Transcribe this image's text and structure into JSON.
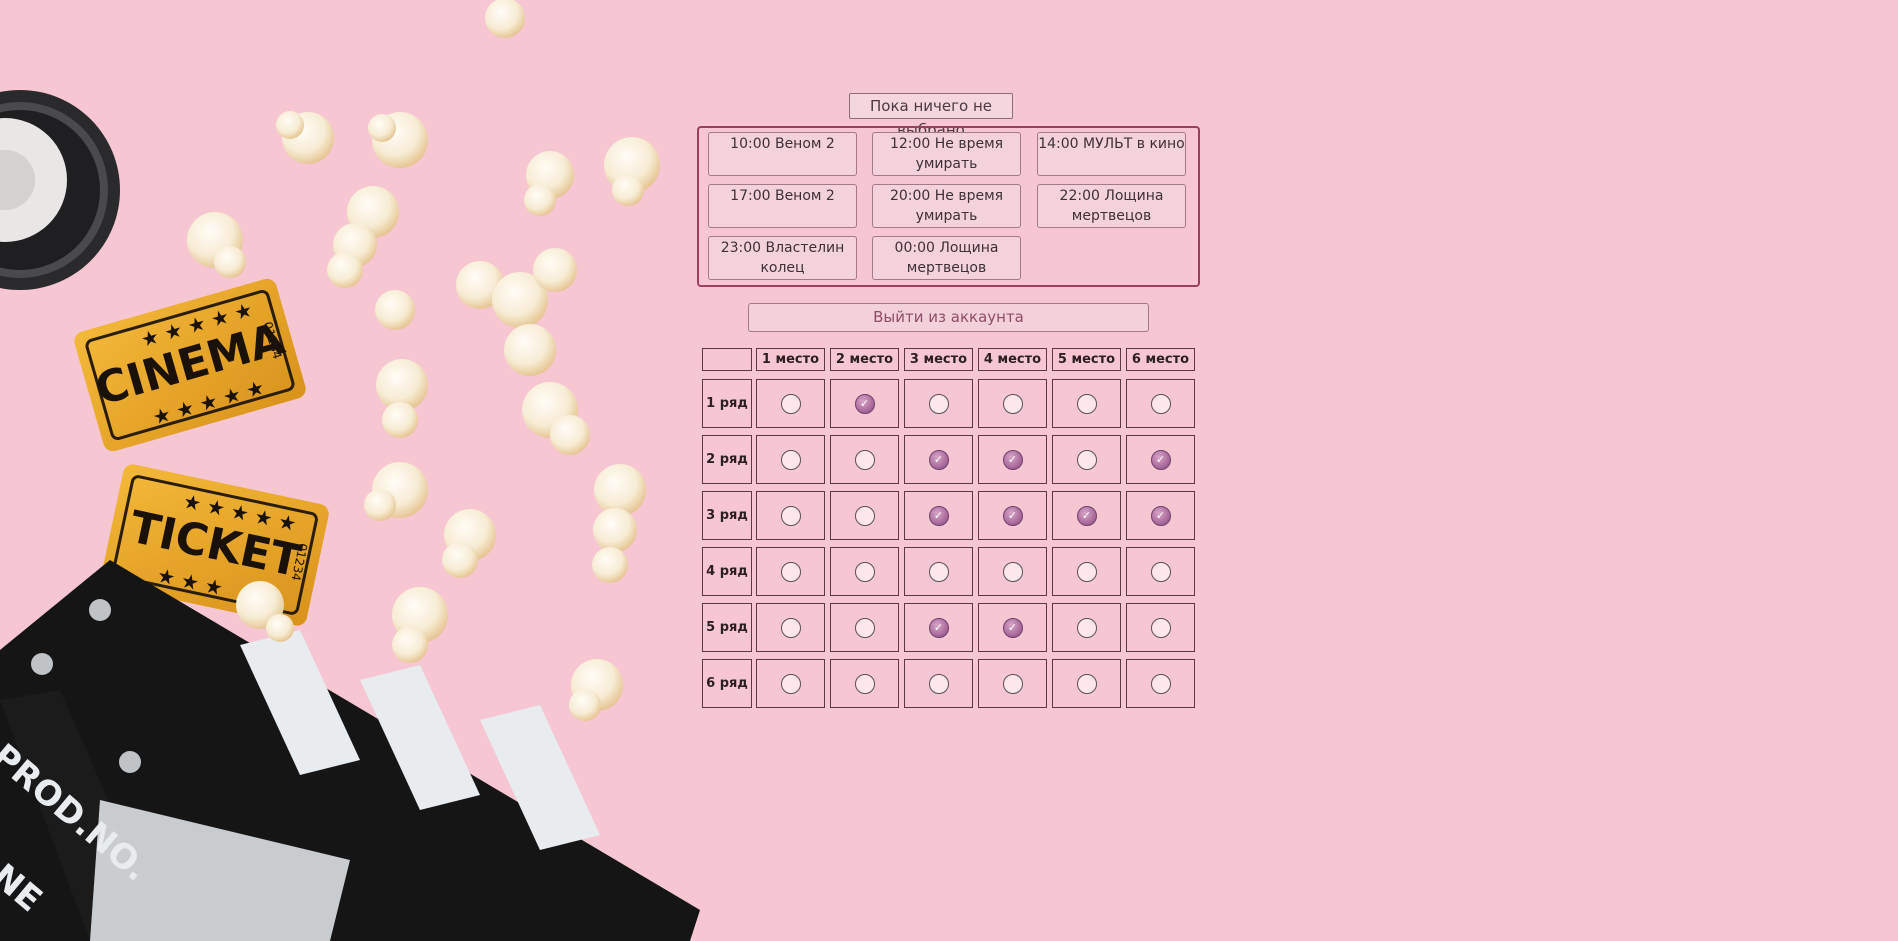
{
  "status": {
    "text": "Пока ничего не выбрано"
  },
  "sessions": [
    {
      "label": "10:00 Веном 2"
    },
    {
      "label": "12:00 Не время умирать"
    },
    {
      "label": "14:00 МУЛЬТ в кино"
    },
    {
      "label": "17:00 Веном 2"
    },
    {
      "label": "20:00 Не время умирать"
    },
    {
      "label": "22:00 Лощина мертвецов"
    },
    {
      "label": "23:00 Властелин колец"
    },
    {
      "label": "00:00 Лощина мертвецов"
    }
  ],
  "logout": {
    "label": "Выйти из аккаунта"
  },
  "seat_grid": {
    "columns": [
      "1 место",
      "2 место",
      "3 место",
      "4 место",
      "5 место",
      "6 место"
    ],
    "rows": [
      {
        "label": "1 ряд",
        "seats": [
          false,
          true,
          false,
          false,
          false,
          false
        ]
      },
      {
        "label": "2 ряд",
        "seats": [
          false,
          false,
          true,
          true,
          false,
          true
        ]
      },
      {
        "label": "3 ряд",
        "seats": [
          false,
          false,
          true,
          true,
          true,
          true
        ]
      },
      {
        "label": "4 ряд",
        "seats": [
          false,
          false,
          false,
          false,
          false,
          false
        ]
      },
      {
        "label": "5 ряд",
        "seats": [
          false,
          false,
          true,
          true,
          false,
          false
        ]
      },
      {
        "label": "6 ряд",
        "seats": [
          false,
          false,
          false,
          false,
          false,
          false
        ]
      }
    ]
  },
  "background": {
    "ticket_1": {
      "text": "CINEMA",
      "number": "01234"
    },
    "ticket_2": {
      "text": "TICKET",
      "number": "01234"
    },
    "clapperboard": {
      "text": "PROD.NO.",
      "text2": "NE"
    }
  },
  "colors": {
    "background": "#f6c6d2",
    "accent": "#9b3f5c",
    "checked_seat": "#a9679a",
    "ticket": "#e8a521"
  },
  "icons": {
    "seat_checked": "check-icon"
  }
}
